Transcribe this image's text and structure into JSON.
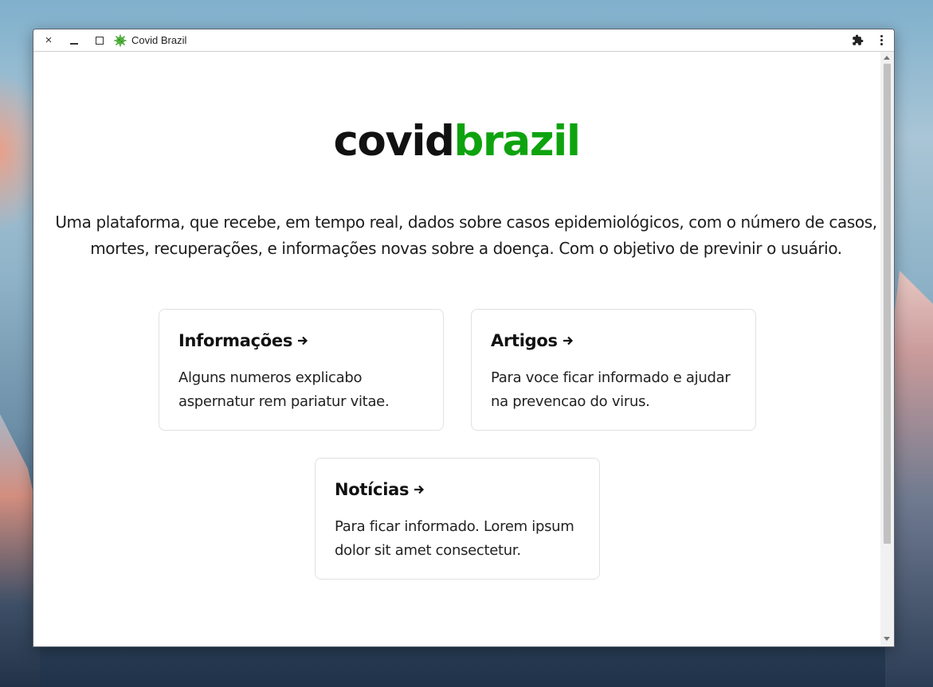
{
  "window": {
    "tab_title": "Covid Brazil",
    "controls": {
      "close_icon": "×"
    },
    "icons": [
      "close-icon",
      "minimize-icon",
      "maximize-icon",
      "virus-favicon-icon",
      "extensions-puzzle-icon",
      "more-vert-icon"
    ]
  },
  "page": {
    "brand": {
      "part1": "covid",
      "part2": "brazil",
      "accent_color": "#0ea30e"
    },
    "tagline": "Uma plataforma, que recebe, em tempo real, dados sobre casos epidemiológicos, com o número de casos, mortes, recuperações, e informações novas sobre a doença. Com o objetivo de previnir o usuário.",
    "cards": [
      {
        "title": "Informações",
        "description": "Alguns numeros explicabo aspernatur rem pariatur vitae."
      },
      {
        "title": "Artigos",
        "description": "Para voce ficar informado e ajudar na prevencao do virus."
      },
      {
        "title": "Notícias",
        "description": "Para ficar informado. Lorem ipsum dolor sit amet consectetur."
      }
    ]
  }
}
